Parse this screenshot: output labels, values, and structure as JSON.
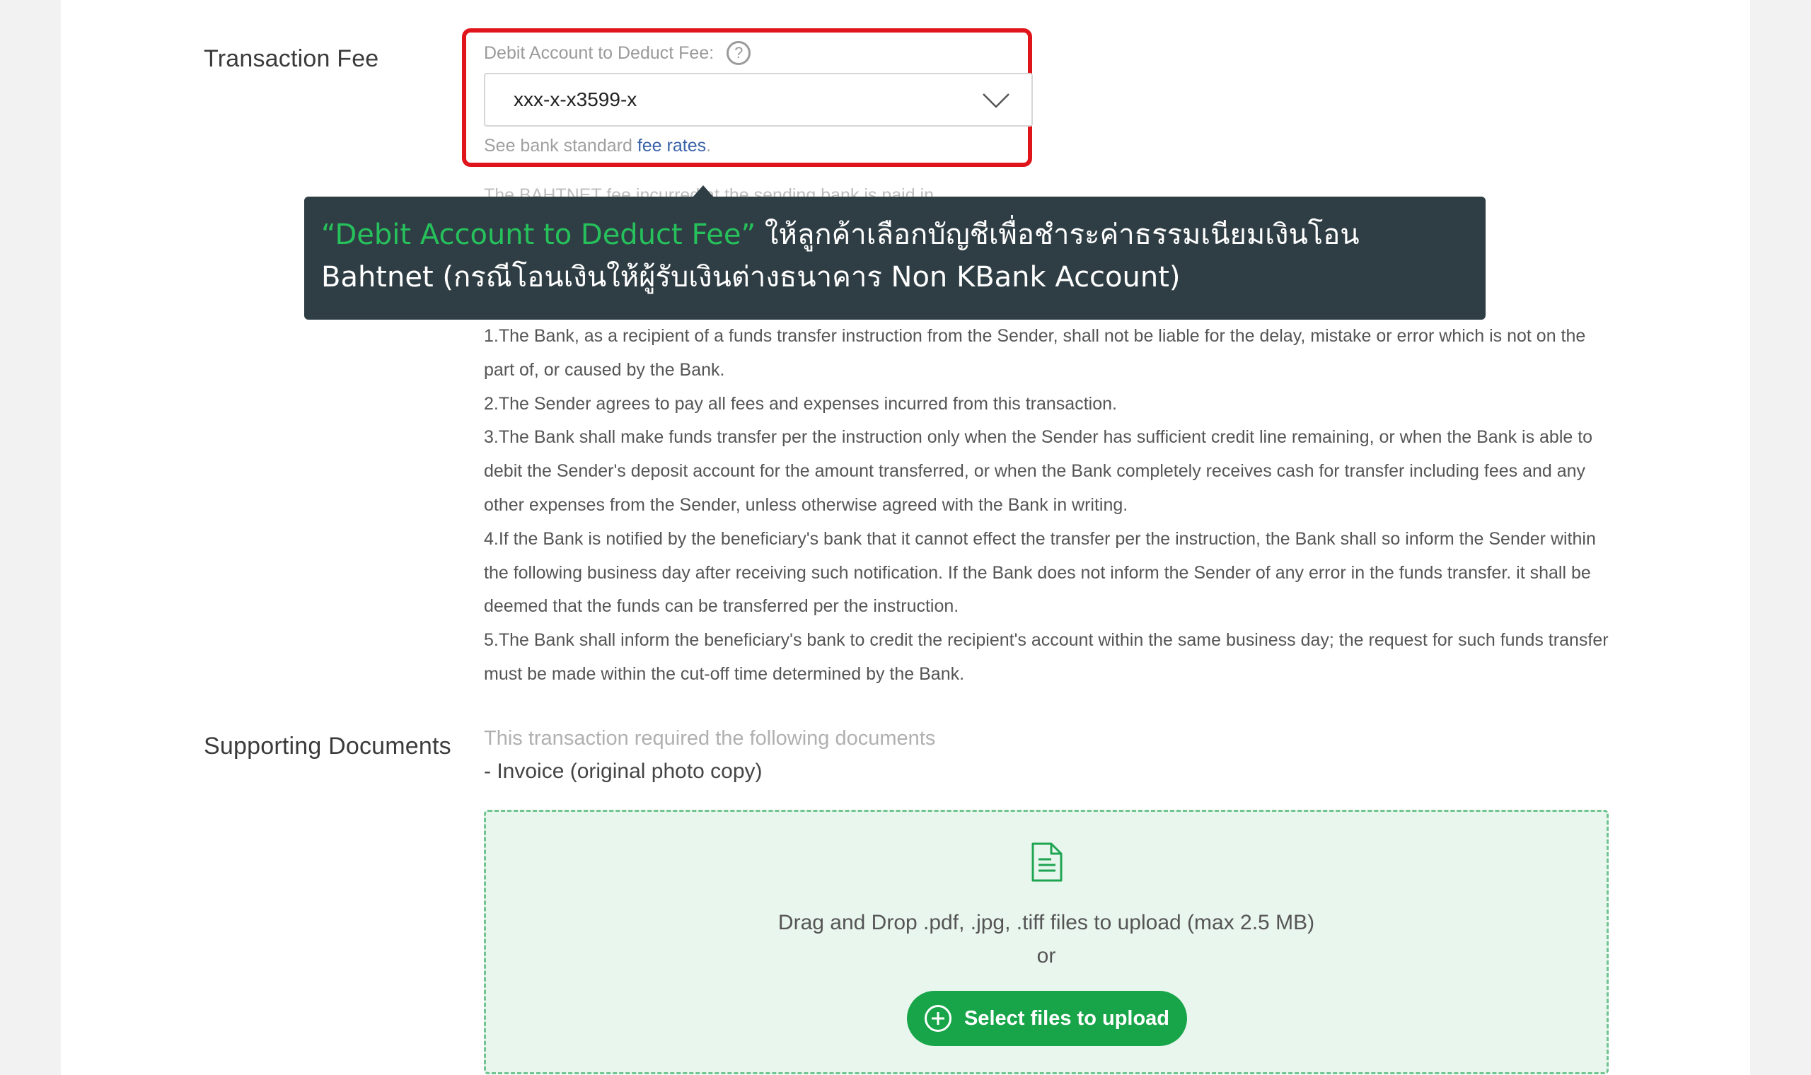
{
  "transaction_fee": {
    "section_label": "Transaction Fee",
    "caption": "Debit Account to Deduct Fee:",
    "help_icon": "?",
    "selected_account": "xxx-x-x3599-x",
    "note_prefix": "See bank standard ",
    "note_link": "fee rates",
    "note_suffix": ".",
    "partially_hidden_text": "The BAHTNET fee incurred at the sending bank is paid in"
  },
  "tooltip": {
    "highlight": "“Debit Account to Deduct Fee”",
    "text": " ให้ลูกค้าเลือกบัญชีเพื่อชำระค่าธรรมเนียมเงินโอน Bahtnet (กรณีโอนเงินให้ผู้รับเงินต่างธนาคาร Non KBank Account)"
  },
  "terms": [
    "1.The Bank, as a recipient of a funds transfer instruction from the Sender, shall not be liable for the delay, mistake or error which is not on the part of, or caused by the Bank.",
    "2.The Sender agrees to pay all fees and expenses incurred from this transaction.",
    "3.The Bank shall make funds transfer per the instruction only when the Sender has sufficient credit line remaining, or when the Bank is able to debit the Sender's deposit account for the amount transferred, or when the Bank completely receives cash for transfer including fees and any other expenses from the Sender, unless otherwise agreed with the Bank in writing.",
    "4.If the Bank is notified by the beneficiary's bank that it cannot effect the transfer per the instruction, the Bank shall so inform the Sender within the following business day after receiving such notification. If the Bank does not inform the Sender of any error in the funds transfer. it shall be deemed that the funds can be transferred per the instruction.",
    "5.The Bank shall inform the beneficiary's bank to credit the recipient's account within the same business day; the request for such funds transfer must be made within the cut-off time determined by the Bank."
  ],
  "supporting_documents": {
    "section_label": "Supporting Documents",
    "hint": "This transaction required the following documents",
    "item": "- Invoice (original photo copy)",
    "dropzone_text": "Drag and Drop .pdf, .jpg, .tiff files to upload (max 2.5 MB)",
    "dropzone_or": "or",
    "upload_button": "Select files to upload"
  },
  "icons": {
    "help": "question-circle-icon",
    "dropdown": "chevron-down-icon",
    "file": "document-icon",
    "add": "plus-circle-icon"
  },
  "colors": {
    "highlight_border": "#e0151c",
    "primary_green": "#18a549",
    "tooltip_bg": "#2f3e45",
    "tooltip_highlight": "#26c15b",
    "link": "#3b62a8"
  }
}
